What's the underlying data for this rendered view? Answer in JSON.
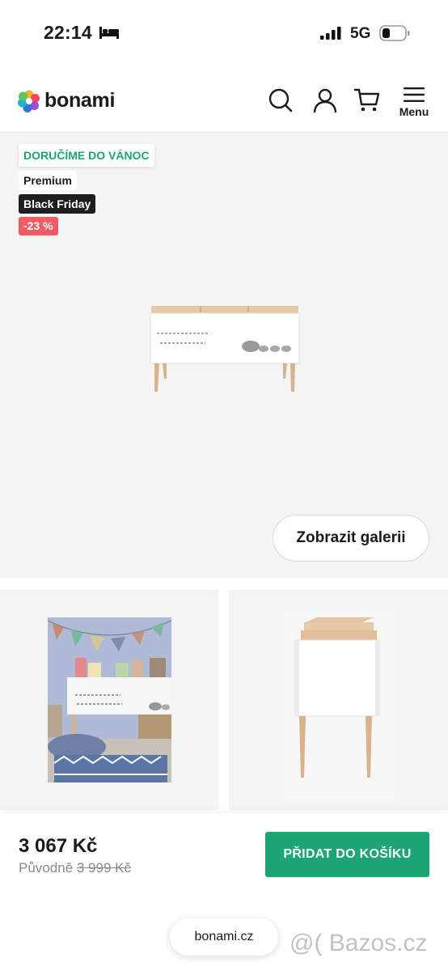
{
  "status_bar": {
    "time": "22:14",
    "network": "5G",
    "icons": [
      "bed-icon",
      "signal-icon",
      "battery-icon"
    ]
  },
  "header": {
    "logo_text": "bonami",
    "icons": [
      "search-icon",
      "user-icon",
      "cart-icon",
      "menu-icon"
    ],
    "menu_label": "Menu"
  },
  "product": {
    "badges": {
      "delivery": "DORUČÍME DO VÁNOC",
      "premium": "Premium",
      "black_friday": "Black Friday",
      "discount": "-23 %"
    },
    "gallery_button": "Zobrazit galerii",
    "price": "3 067 Kč",
    "original_label": "Původně",
    "original_price": "3 999 Kč",
    "add_to_cart": "PŘIDAT DO KOŠÍKU"
  },
  "browser": {
    "url": "bonami.cz"
  },
  "watermark": "@( Bazos.cz",
  "colors": {
    "accent_green": "#1ba674",
    "discount_red": "#f35b64",
    "black_friday_bg": "#1e1e1e"
  }
}
